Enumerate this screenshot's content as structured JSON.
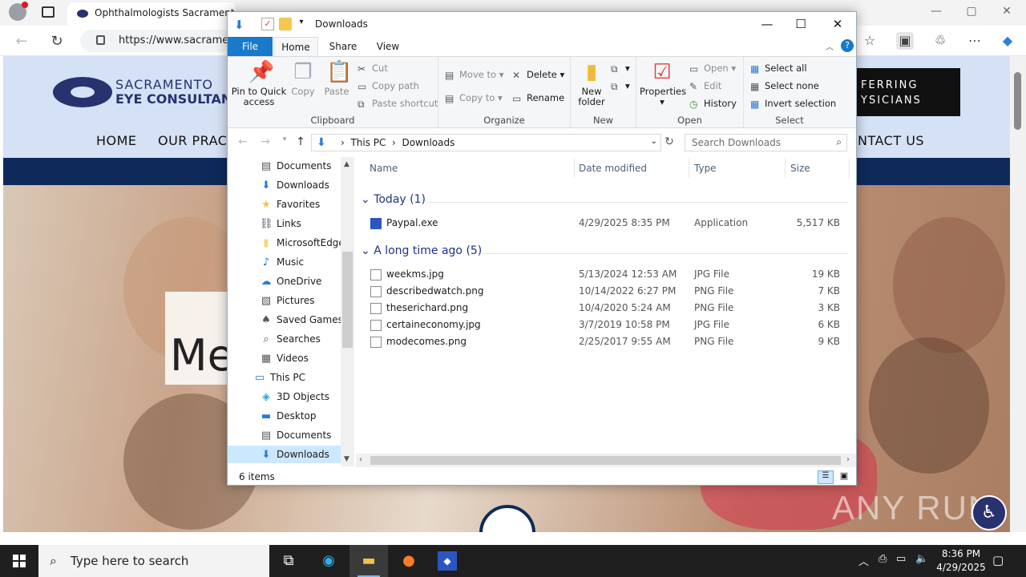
{
  "browser": {
    "tab_title": "Ophthalmologists Sacramento C",
    "url": "https://www.sacramen",
    "window_buttons": [
      "—",
      "▢",
      "✕"
    ]
  },
  "website": {
    "logo_line1": "SACRAMENTO",
    "logo_line2": "EYE CONSULTANT",
    "nav": [
      "HOME",
      "OUR PRACT",
      "NTACT US"
    ],
    "referring_box": [
      "FERRING",
      "YSICIANS"
    ],
    "hero_text": "Me",
    "watermark": "ANY RUN",
    "colors": {
      "navy": "#0e2a5a",
      "brand": "#27326f"
    }
  },
  "explorer": {
    "title": "Downloads",
    "tabs": {
      "file": "File",
      "home": "Home",
      "share": "Share",
      "view": "View"
    },
    "ribbon": {
      "clipboard": {
        "label": "Clipboard",
        "pin": "Pin to Quick access",
        "copy": "Copy",
        "paste": "Paste",
        "cut": "Cut",
        "copy_path": "Copy path",
        "paste_shortcut": "Paste shortcut"
      },
      "organize": {
        "label": "Organize",
        "move_to": "Move to",
        "copy_to": "Copy to",
        "delete": "Delete",
        "rename": "Rename"
      },
      "new": {
        "label": "New",
        "new_folder": "New folder"
      },
      "open": {
        "label": "Open",
        "properties": "Properties",
        "open": "Open",
        "edit": "Edit",
        "history": "History"
      },
      "select": {
        "label": "Select",
        "select_all": "Select all",
        "select_none": "Select none",
        "invert": "Invert selection"
      }
    },
    "breadcrumb": [
      "This PC",
      "Downloads"
    ],
    "search_placeholder": "Search Downloads",
    "nav_pane": [
      {
        "label": "Documents",
        "icon": "document-icon"
      },
      {
        "label": "Downloads",
        "icon": "download-icon"
      },
      {
        "label": "Favorites",
        "icon": "star-icon"
      },
      {
        "label": "Links",
        "icon": "link-icon"
      },
      {
        "label": "MicrosoftEdge",
        "icon": "folder-icon"
      },
      {
        "label": "Music",
        "icon": "music-icon"
      },
      {
        "label": "OneDrive",
        "icon": "cloud-icon"
      },
      {
        "label": "Pictures",
        "icon": "pictures-icon"
      },
      {
        "label": "Saved Games",
        "icon": "games-icon"
      },
      {
        "label": "Searches",
        "icon": "search-icon"
      },
      {
        "label": "Videos",
        "icon": "video-icon"
      },
      {
        "label": "This PC",
        "icon": "computer-icon"
      },
      {
        "label": "3D Objects",
        "icon": "cube-icon"
      },
      {
        "label": "Desktop",
        "icon": "desktop-icon"
      },
      {
        "label": "Documents",
        "icon": "document-icon"
      },
      {
        "label": "Downloads",
        "icon": "download-icon"
      }
    ],
    "columns": [
      "Name",
      "Date modified",
      "Type",
      "Size"
    ],
    "groups": [
      {
        "title": "Today (1)",
        "files": [
          {
            "name": "Paypal.exe",
            "date": "4/29/2025 8:35 PM",
            "type": "Application",
            "size": "5,517 KB"
          }
        ]
      },
      {
        "title": "A long time ago (5)",
        "files": [
          {
            "name": "weekms.jpg",
            "date": "5/13/2024 12:53 AM",
            "type": "JPG File",
            "size": "19 KB"
          },
          {
            "name": "describedwatch.png",
            "date": "10/14/2022 6:27 PM",
            "type": "PNG File",
            "size": "7 KB"
          },
          {
            "name": "theserichard.png",
            "date": "10/4/2020 5:24 AM",
            "type": "PNG File",
            "size": "3 KB"
          },
          {
            "name": "certaineconomy.jpg",
            "date": "3/7/2019 10:58 PM",
            "type": "JPG File",
            "size": "6 KB"
          },
          {
            "name": "modecomes.png",
            "date": "2/25/2017 9:55 AM",
            "type": "PNG File",
            "size": "9 KB"
          }
        ]
      }
    ],
    "status": "6 items"
  },
  "taskbar": {
    "search_placeholder": "Type here to search",
    "time": "8:36 PM",
    "date": "4/29/2025"
  }
}
